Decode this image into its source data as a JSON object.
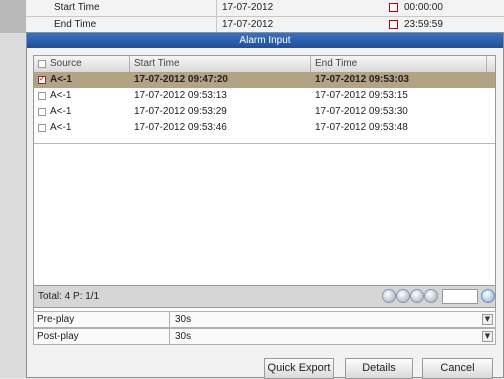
{
  "background": {
    "start_label": "Start Time",
    "start_date": "17-07-2012",
    "start_time": "00:00:00",
    "end_label": "End Time",
    "end_date": "17-07-2012",
    "end_time": "23:59:59",
    "calendar_icon": "calendar-icon"
  },
  "dialog": {
    "title": "Alarm Input",
    "columns": {
      "source": "Source",
      "start": "Start Time",
      "end": "End Time"
    },
    "rows": [
      {
        "source": "A<-1",
        "start": "17-07-2012 09:47:20",
        "end": "17-07-2012 09:53:03",
        "checked": true,
        "selected": true
      },
      {
        "source": "A<-1",
        "start": "17-07-2012 09:53:13",
        "end": "17-07-2012 09:53:15",
        "checked": false,
        "selected": false
      },
      {
        "source": "A<-1",
        "start": "17-07-2012 09:53:29",
        "end": "17-07-2012 09:53:30",
        "checked": false,
        "selected": false
      },
      {
        "source": "A<-1",
        "start": "17-07-2012 09:53:46",
        "end": "17-07-2012 09:53:48",
        "checked": false,
        "selected": false
      }
    ],
    "status": "Total: 4  P: 1/1",
    "pager_icons": [
      "first-page-icon",
      "prev-page-icon",
      "next-page-icon",
      "last-page-icon",
      "go-page-icon"
    ],
    "pre_play": {
      "label": "Pre-play",
      "value": "30s"
    },
    "post_play": {
      "label": "Post-play",
      "value": "30s"
    },
    "dropdown_icon": "chevron-down-icon",
    "buttons": {
      "quick_export": "Quick Export",
      "details": "Details",
      "cancel": "Cancel"
    }
  },
  "colors": {
    "title_bar": "#1f4f9c",
    "selected_row": "#b2a385",
    "calendar_red": "#b30000"
  }
}
